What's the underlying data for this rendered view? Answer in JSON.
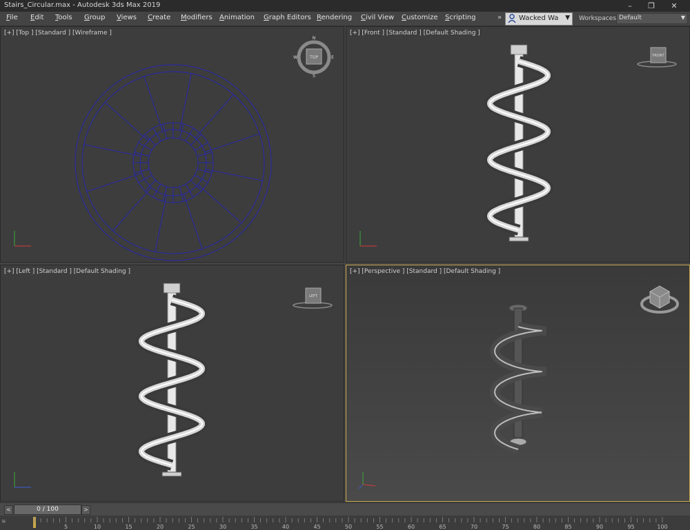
{
  "window": {
    "title": "Stairs_Circular.max - Autodesk 3ds Max 2019",
    "controls": [
      "–",
      "❐",
      "✕"
    ]
  },
  "menu": {
    "items": [
      {
        "first": "F",
        "rest": "ile"
      },
      {
        "first": "E",
        "rest": "dit"
      },
      {
        "first": "T",
        "rest": "ools"
      },
      {
        "first": "G",
        "rest": "roup"
      },
      {
        "first": "V",
        "rest": "iews"
      },
      {
        "first": "C",
        "rest": "reate"
      },
      {
        "first": "M",
        "rest": "odifiers"
      },
      {
        "first": "A",
        "rest": "nimation"
      },
      {
        "first": "G",
        "rest": "raph Editors"
      },
      {
        "first": "R",
        "rest": "endering"
      },
      {
        "first": "C",
        "rest": "ivil View"
      },
      {
        "first": "C",
        "rest": "ustomize"
      },
      {
        "first": "S",
        "rest": "cripting"
      }
    ],
    "overflow": "»",
    "user": {
      "name": "Wacked Wa",
      "icon": "user-icon",
      "caret": "▼"
    },
    "workspaces_label": "Workspaces:",
    "workspace_value": "Default",
    "workspace_caret": "▼"
  },
  "viewports": {
    "top": {
      "label": "[+] [Top ] [Standard ] [Wireframe ]",
      "cube_face": "TOP",
      "compass": {
        "n": "N",
        "s": "S",
        "w": "W",
        "e": "E"
      }
    },
    "front": {
      "label": "[+] [Front ] [Standard ] [Default Shading ]",
      "cube_face": "FRONT"
    },
    "left": {
      "label": "[+] [Left ] [Standard ] [Default Shading ]",
      "cube_face": "LEFT"
    },
    "perspective": {
      "label": "[+] [Perspective ] [Standard ] [Default Shading ]"
    }
  },
  "timeline": {
    "frame_display": "0 / 100",
    "prev": "<",
    "next": ">",
    "corner": "≋",
    "ticks": [
      "0",
      "5",
      "10",
      "15",
      "20",
      "25",
      "30",
      "35",
      "40",
      "45",
      "50",
      "55",
      "60",
      "65",
      "70",
      "75",
      "80",
      "85",
      "90",
      "95",
      "100"
    ]
  },
  "colors": {
    "wireframe": "#2a2a9a",
    "active_border": "#c9a84a",
    "viewport_bg": "#3d3d3d"
  }
}
